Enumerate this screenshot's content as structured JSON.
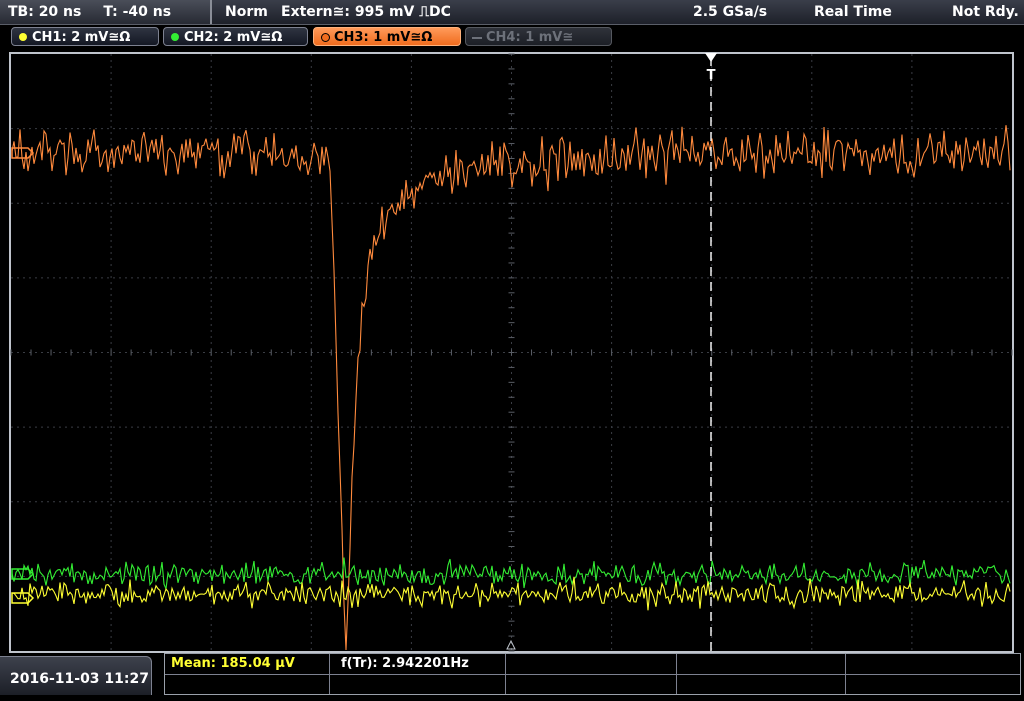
{
  "topbar": {
    "timebase": "TB: 20 ns",
    "trigger_offset": "T: -40 ns",
    "trigger_mode": "Norm",
    "trigger_source": "Extern≅: 995 mV ⎍DC",
    "sample_rate": "2.5 GSa/s",
    "acq_mode": "Real Time",
    "status": "Not Rdy."
  },
  "channels": [
    {
      "label": "CH1: 2 mV≅Ω",
      "color": "#ffff33",
      "state": "on"
    },
    {
      "label": "CH2: 2 mV≅Ω",
      "color": "#33ee33",
      "state": "on"
    },
    {
      "label": "CH3: 1 mV≅Ω",
      "color": "#ff8a3d",
      "state": "selected"
    },
    {
      "label": "CH4: 1 mV≅",
      "color": "#6d717a",
      "state": "off"
    }
  ],
  "trigger_marker": "T",
  "traces": {
    "ch3_color": "#ff8a3d",
    "ch2_color": "#33ee33",
    "ch1_color": "#ffff33"
  },
  "bottombar": {
    "datetime": "2016-11-03 11:27",
    "meas1": "Mean: 185.04 µV",
    "meas2": "f(Tr): 2.942201Hz",
    "meas1_color": "#ffff33"
  }
}
